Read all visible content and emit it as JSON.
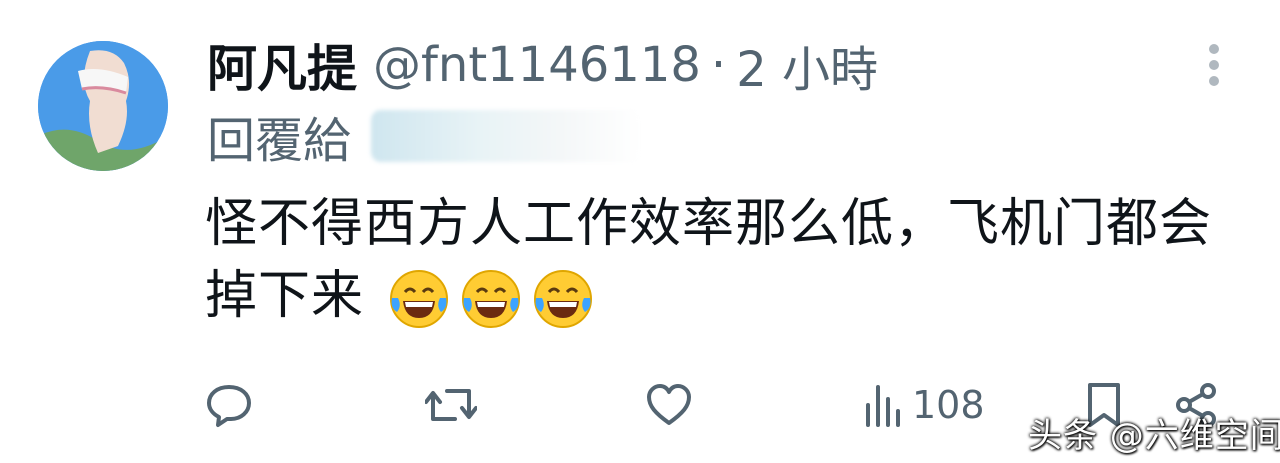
{
  "tweet": {
    "display_name": "阿凡提",
    "handle": "@fnt1146118",
    "separator": "·",
    "timestamp": "2 小時",
    "reply_label": "回覆給",
    "body_text": "怪不得西方人工作效率那么低，飞机门都会掉下来",
    "emoji_count": 3
  },
  "actions": {
    "views": "108"
  },
  "watermark": "头条 @六维空间",
  "colors": {
    "text_primary": "#0f1419",
    "text_secondary": "#536471",
    "icon": "#536471",
    "avatar_bg": "#4a9be8"
  },
  "icons": [
    "reply-icon",
    "retweet-icon",
    "like-icon",
    "views-icon",
    "bookmark-icon",
    "share-icon",
    "more-icon"
  ]
}
